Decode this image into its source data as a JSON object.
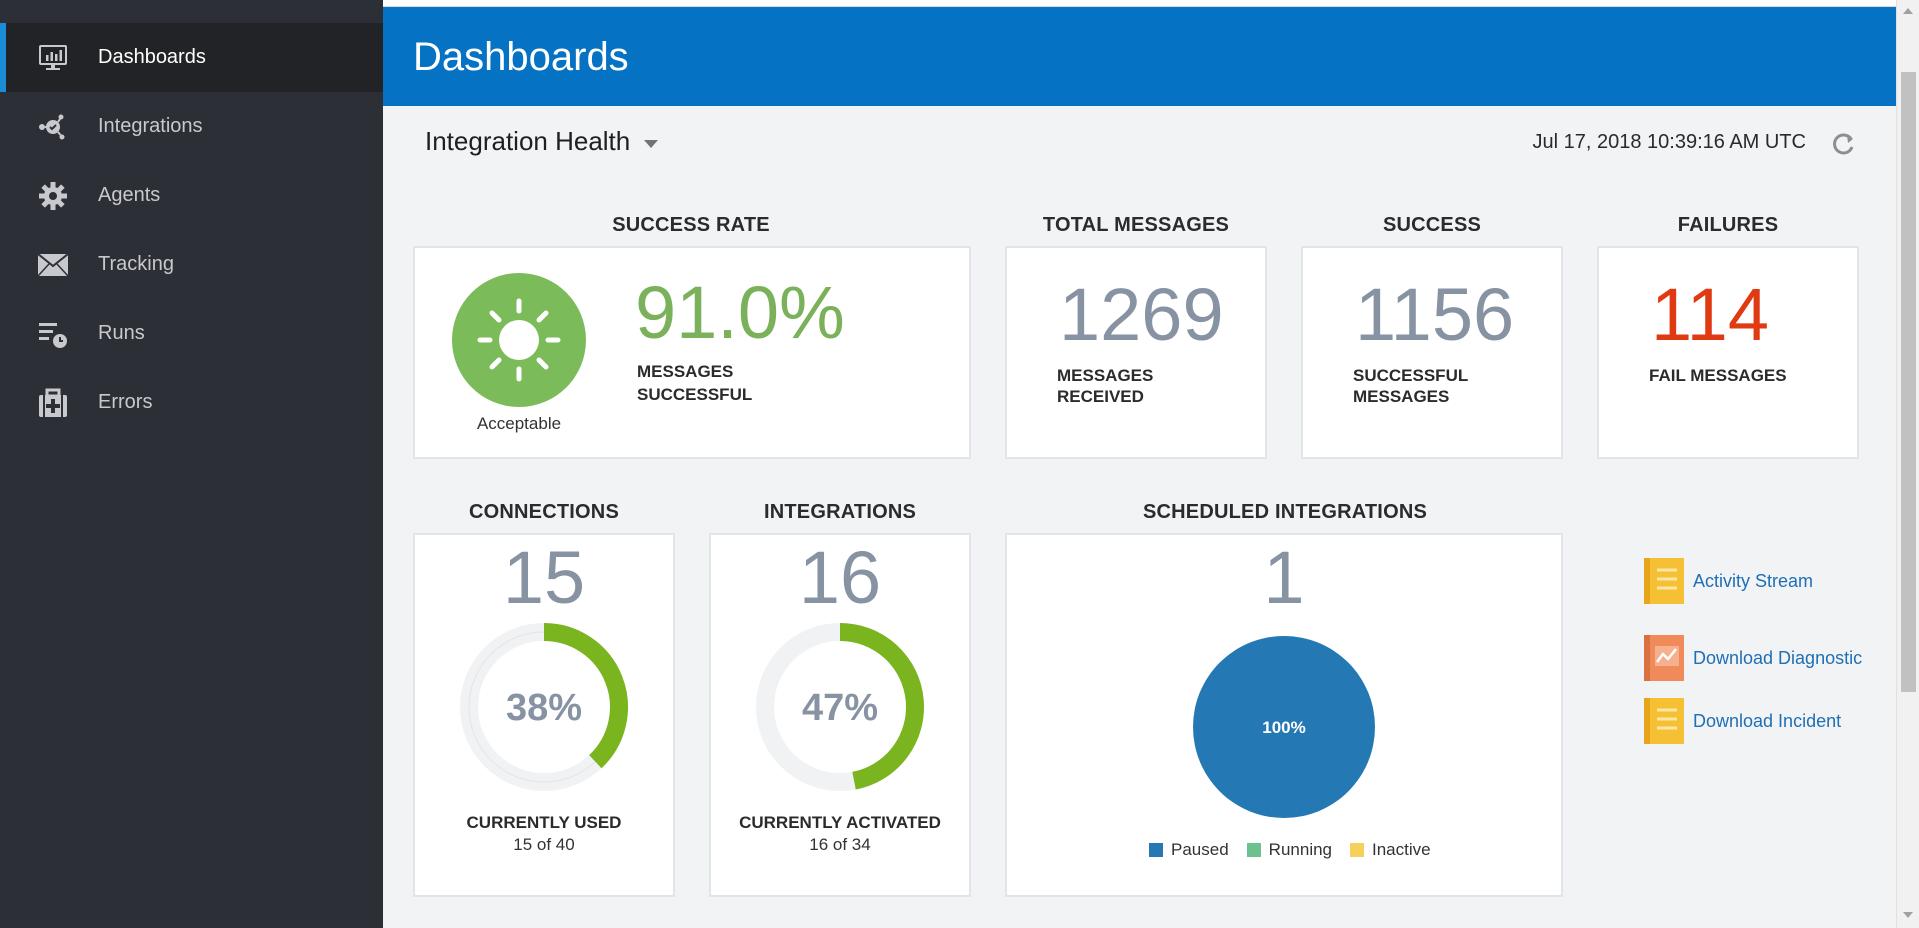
{
  "sidebar": {
    "items": [
      {
        "label": "Dashboards",
        "icon": "monitor-chart-icon",
        "active": true
      },
      {
        "label": "Integrations",
        "icon": "integrations-icon",
        "active": false
      },
      {
        "label": "Agents",
        "icon": "gear-icon",
        "active": false
      },
      {
        "label": "Tracking",
        "icon": "envelope-icon",
        "active": false
      },
      {
        "label": "Runs",
        "icon": "runs-clock-icon",
        "active": false
      },
      {
        "label": "Errors",
        "icon": "medical-kit-icon",
        "active": false
      }
    ]
  },
  "header": {
    "title": "Dashboards"
  },
  "toolbar": {
    "health_label": "Integration Health",
    "timestamp": "Jul 17, 2018 10:39:16 AM UTC"
  },
  "success_rate": {
    "title": "SUCCESS RATE",
    "value": "91.0%",
    "caption_line1": "MESSAGES",
    "caption_line2": "SUCCESSFUL",
    "status": "Acceptable",
    "status_color": "#7cbb5a",
    "value_color": "#7ab15a"
  },
  "total_messages": {
    "title": "TOTAL MESSAGES",
    "value": "1269",
    "caption_line1": "MESSAGES",
    "caption_line2": "RECEIVED"
  },
  "success": {
    "title": "SUCCESS",
    "value": "1156",
    "caption_line1": "SUCCESSFUL",
    "caption_line2": "MESSAGES"
  },
  "failures": {
    "title": "FAILURES",
    "value": "114",
    "caption": "FAIL MESSAGES",
    "value_color": "#e03a12"
  },
  "connections": {
    "title": "CONNECTIONS",
    "value": "15",
    "percent_label": "38%",
    "percent": 38,
    "caption": "CURRENTLY USED",
    "detail": "15 of 40"
  },
  "integrations": {
    "title": "INTEGRATIONS",
    "value": "16",
    "percent_label": "47%",
    "percent": 47,
    "caption": "CURRENTLY ACTIVATED",
    "detail": "16 of 34"
  },
  "scheduled": {
    "title": "SCHEDULED INTEGRATIONS",
    "value": "1",
    "pie_label": "100%",
    "legend": [
      {
        "label": "Paused",
        "color": "#2479b4"
      },
      {
        "label": "Running",
        "color": "#6cc18e"
      },
      {
        "label": "Inactive",
        "color": "#f5d05a"
      }
    ]
  },
  "chart_data": {
    "type": "pie",
    "title": "SCHEDULED INTEGRATIONS",
    "categories": [
      "Paused",
      "Running",
      "Inactive"
    ],
    "values": [
      100,
      0,
      0
    ],
    "data_labels": [
      "100%"
    ],
    "legend": "bottom"
  },
  "links": [
    {
      "label": "Activity Stream",
      "icon": "document-icon",
      "color": "#f5c033"
    },
    {
      "label": "Download Diagnostic",
      "icon": "diagnostic-chart-icon",
      "color": "#f08a5a"
    },
    {
      "label": "Download Incident",
      "icon": "document-icon",
      "color": "#f5c033"
    }
  ],
  "accent": {
    "header_blue": "#0572c4",
    "donut_green": "#7ab41f"
  }
}
